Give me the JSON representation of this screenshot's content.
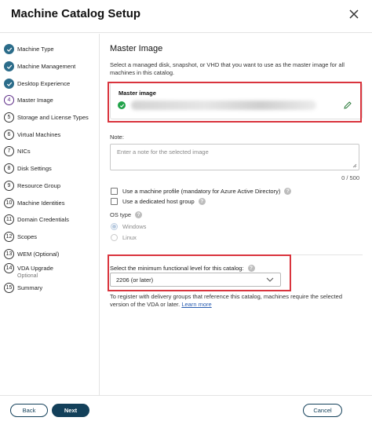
{
  "header": {
    "title": "Machine Catalog Setup",
    "close_icon": "close-icon"
  },
  "sidebar": {
    "steps": [
      {
        "num": "",
        "label": "Machine Type",
        "status": "done"
      },
      {
        "num": "",
        "label": "Machine Management",
        "status": "done"
      },
      {
        "num": "",
        "label": "Desktop Experience",
        "status": "done"
      },
      {
        "num": "4",
        "label": "Master Image",
        "status": "active"
      },
      {
        "num": "5",
        "label": "Storage and License Types",
        "status": "pending"
      },
      {
        "num": "6",
        "label": "Virtual Machines",
        "status": "pending"
      },
      {
        "num": "7",
        "label": "NICs",
        "status": "pending"
      },
      {
        "num": "8",
        "label": "Disk Settings",
        "status": "pending"
      },
      {
        "num": "9",
        "label": "Resource Group",
        "status": "pending"
      },
      {
        "num": "10",
        "label": "Machine Identities",
        "status": "pending"
      },
      {
        "num": "11",
        "label": "Domain Credentials",
        "status": "pending"
      },
      {
        "num": "12",
        "label": "Scopes",
        "status": "pending"
      },
      {
        "num": "13",
        "label": "WEM (Optional)",
        "status": "pending"
      },
      {
        "num": "14",
        "label": "VDA Upgrade",
        "sub": "Optional",
        "status": "pending"
      },
      {
        "num": "15",
        "label": "Summary",
        "status": "pending"
      }
    ]
  },
  "main": {
    "heading": "Master Image",
    "description": "Select a managed disk, snapshot, or VHD that you want to use as the master image for all machines in this catalog.",
    "master_image": {
      "label": "Master image"
    },
    "note": {
      "label": "Note:",
      "placeholder": "Enter a note for the selected image",
      "count": "0 / 500"
    },
    "machine_profile": {
      "label": "Use a machine profile (mandatory for Azure Active Directory)"
    },
    "dedicated_host": {
      "label": "Use a dedicated host group"
    },
    "os_type": {
      "label": "OS type",
      "options": [
        "Windows",
        "Linux"
      ],
      "selected": "Windows"
    },
    "functional_level": {
      "label": "Select the minimum functional level for this catalog:",
      "value": "2206 (or later)"
    },
    "register_text": "To register with delivery groups that reference this catalog, machines require the selected version of the VDA or later.",
    "learn_more": "Learn more"
  },
  "footer": {
    "back": "Back",
    "next": "Next",
    "cancel": "Cancel"
  },
  "colors": {
    "accent": "#13405a",
    "step_done": "#2b6c8a",
    "step_active": "#5b2a86",
    "highlight": "#d9343d",
    "success": "#22a34a"
  }
}
